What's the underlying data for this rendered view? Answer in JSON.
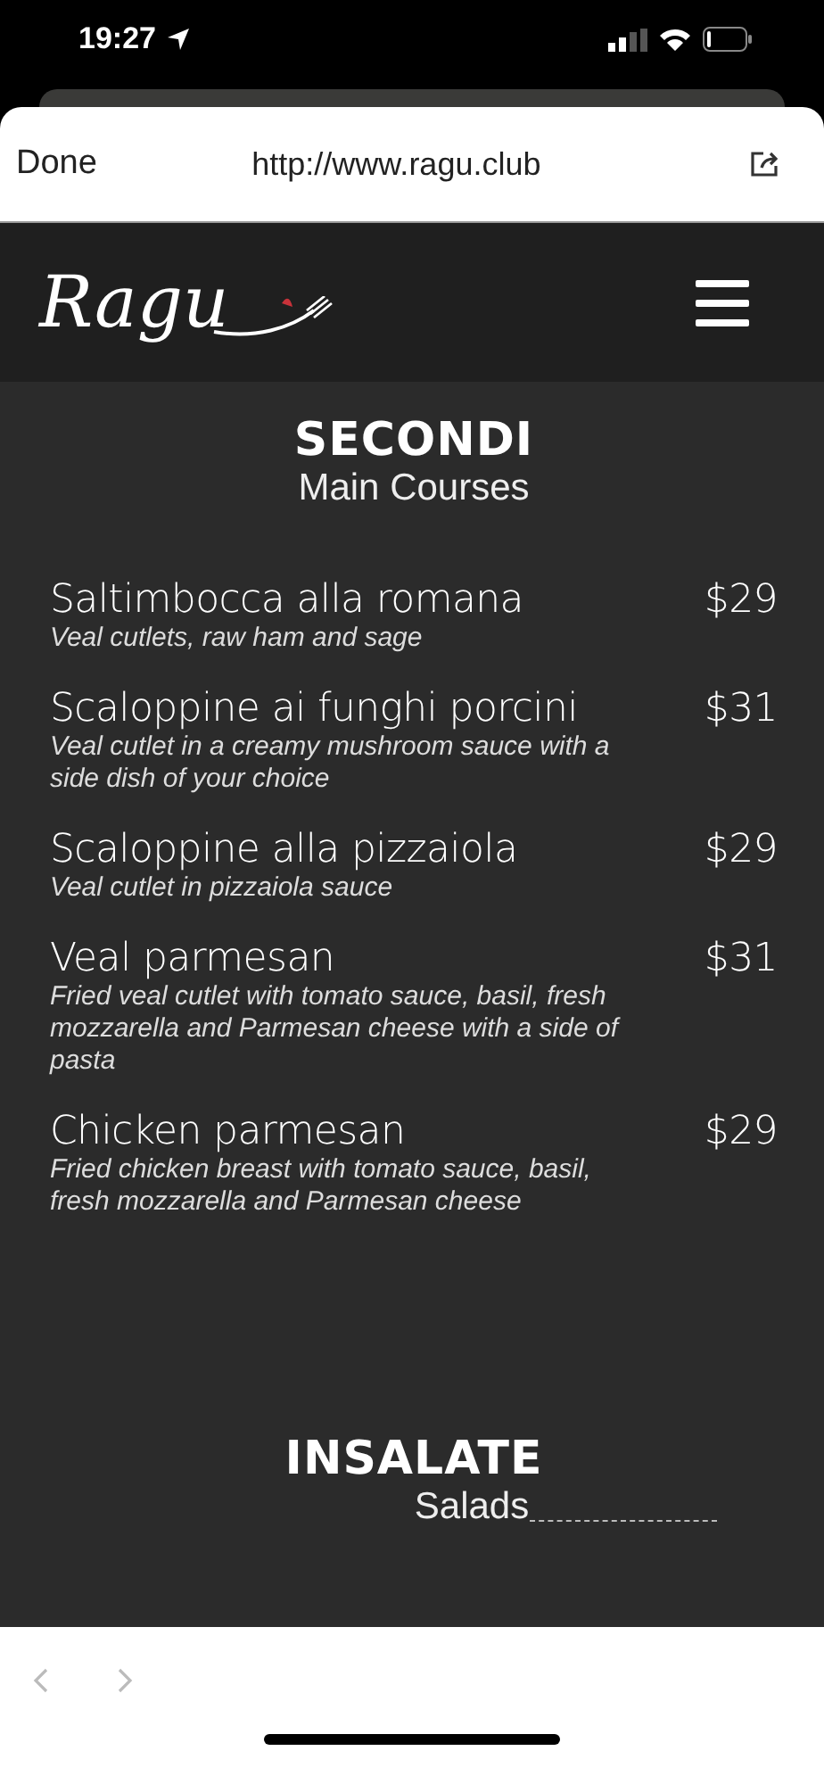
{
  "status_bar": {
    "time": "19:27"
  },
  "browser": {
    "done": "Done",
    "url": "http://www.ragu.club"
  },
  "site": {
    "logo": "Ragu"
  },
  "sections": [
    {
      "title": "SECONDI",
      "subtitle": "Main Courses",
      "items": [
        {
          "name": "Saltimbocca alla romana",
          "price": "$29",
          "description": "Veal cutlets, raw ham and sage"
        },
        {
          "name": "Scaloppine ai funghi porcini",
          "price": "$31",
          "description": "Veal cutlet in a creamy mushroom sauce with a side dish of your choice"
        },
        {
          "name": "Scaloppine alla pizzaiola",
          "price": "$29",
          "description": "Veal cutlet in pizzaiola sauce"
        },
        {
          "name": "Veal parmesan",
          "price": "$31",
          "description": "Fried veal cutlet with tomato sauce, basil, fresh mozzarella and Parmesan cheese with a side of pasta"
        },
        {
          "name": "Chicken parmesan",
          "price": "$29",
          "description": "Fried chicken breast with tomato sauce, basil, fresh mozzarella and Parmesan cheese"
        }
      ]
    },
    {
      "title": "INSALATE",
      "subtitle": "Salads"
    }
  ]
}
